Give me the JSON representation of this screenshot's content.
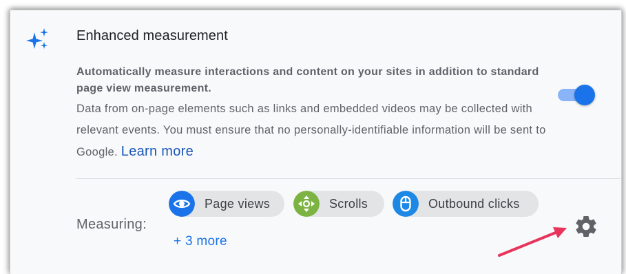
{
  "section": {
    "title": "Enhanced measurement",
    "description_bold": "Automatically measure interactions and content on your sites in addition to standard page view measurement.",
    "description_muted": "Data from on-page elements such as links and embedded videos may be collected with relevant events. You must ensure that no personally-identifiable information will be sent to Google.",
    "learn_more_link": "Learn more",
    "toggle_state": "on"
  },
  "measuring": {
    "label": "Measuring:",
    "chips": [
      {
        "label": "Page views",
        "icon": "eye-icon",
        "color": "#1a73e8"
      },
      {
        "label": "Scrolls",
        "icon": "scroll-arrows-icon",
        "color": "#7cb342"
      },
      {
        "label": "Outbound clicks",
        "icon": "mouse-icon",
        "color": "#1e88e5"
      }
    ],
    "more_link": "+ 3 more"
  },
  "icons": {
    "header": "sparkle-icon",
    "settings": "gear-icon",
    "annotation": "red-arrow-annotation"
  },
  "colors": {
    "accent": "#1a73e8",
    "toggle_track": "#8ab4f8",
    "annotation_arrow": "#e8345a"
  }
}
